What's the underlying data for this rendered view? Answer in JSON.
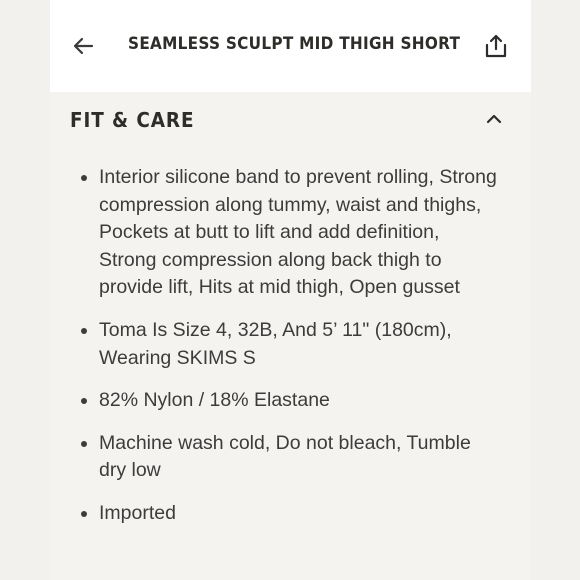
{
  "header": {
    "title": "SEAMLESS SCULPT MID THIGH SHORT",
    "back_icon": "arrow-left-icon",
    "share_icon": "share-upload-icon"
  },
  "section": {
    "title": "FIT & CARE",
    "expanded": true,
    "toggle_icon": "chevron-up-icon",
    "items": [
      "Interior silicone band to prevent rolling, Strong compression along tummy, waist and thighs, Pockets at butt to lift and add definition, Strong compression along back thigh to provide lift, Hits at mid thigh, Open gusset",
      "Toma Is Size 4, 32B, And 5’ 11\" (180cm), Wearing SKIMS S",
      "82% Nylon / 18% Elastane",
      "Machine wash cold, Do not bleach, Tumble dry low",
      "Imported"
    ]
  },
  "colors": {
    "page_background": "#f3f1ee",
    "header_background": "#ffffff",
    "text": "#3c3c3c",
    "heading": "#2e2d2a"
  }
}
